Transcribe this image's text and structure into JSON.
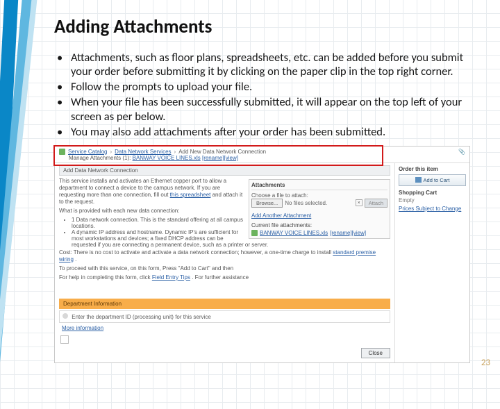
{
  "slide": {
    "title": "Adding Attachments",
    "bullets": [
      "Attachments, such as floor plans, spreadsheets, etc.  can be added before you submit your order before submitting it by clicking on the paper clip in the top right corner.",
      "Follow the prompts to upload your file.",
      "When your file has been successfully submitted, it will appear on the top left of your screen as per below.",
      "You may also add attachments after your order has been submitted."
    ],
    "page_number": "23"
  },
  "shot": {
    "breadcrumb": {
      "a": "Service Catalog",
      "b": "Data Network Services",
      "c": "Add New Data Network Connection"
    },
    "manage": {
      "label": "Manage Attachments (1):",
      "file": "BANWAY VOICE LINES.xls",
      "ops": "[rename][view]"
    },
    "section_title": "Add Data Network Connection",
    "desc1_a": "This service installs and activates an Ethernet copper port to allow a department to connect a device to the campus network. If you are requesting more than one connection, fill out ",
    "desc1_link": "this spreadsheet",
    "desc1_b": " and attach it to the request.",
    "provided": "What is provided with each new data connection:",
    "pl1": "1 Data network connection. This is the standard offering at all campus locations.",
    "pl2": "A dynamic IP address and hostname. Dynamic IP's are sufficient for most workstations and devices; a fixed DHCP address can be requested if you are connecting a permanent device, such as a printer or server.",
    "cost_a": "Cost: There is no cost to activate and activate a data network connection; however, a one-time charge to install ",
    "cost_link": "standard premise wiring",
    "cost_b": ".",
    "proceed_a": "To proceed with this service, on this form, Press \"Add to Cart\" and then ",
    "help_a": "For help in completing this form, click ",
    "help_link": "Field Entry Tips",
    "help_b": ". For further assistance",
    "attach": {
      "heading": "Attachments",
      "choose": "Choose a file to attach:",
      "browse": "Browse...",
      "nosel": "No files selected.",
      "attach_btn": "Attach",
      "add_another": "Add Another Attachment",
      "current": "Current file attachments:",
      "file": "BANWAY VOICE LINES.xls",
      "ops": "[rename][view]"
    },
    "yellow": "Department Information",
    "dept_field": "Enter the department ID (processing unit) for this service",
    "more_info": "More information",
    "right": {
      "order": "Order this item",
      "add_cart": "Add to Cart",
      "shopping": "Shopping Cart",
      "empty": "Empty",
      "subject": "Prices Subject to Change"
    },
    "close_btn": "Close"
  }
}
